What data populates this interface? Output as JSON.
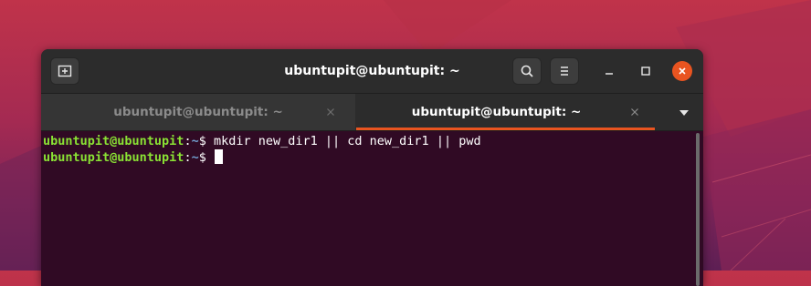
{
  "colors": {
    "accent": "#e95420",
    "terminal_bg": "#300a24",
    "prompt_user": "#8ae234",
    "prompt_path": "#729fcf"
  },
  "window": {
    "title": "ubuntupit@ubuntupit: ~",
    "buttons": {
      "new_tab": "new-tab-icon",
      "search": "search-icon",
      "menu": "hamburger-menu-icon",
      "minimize": "minimize-icon",
      "maximize": "maximize-icon",
      "close": "close-icon"
    }
  },
  "tabs": [
    {
      "label": "ubuntupit@ubuntupit: ~",
      "active": false,
      "close": "×"
    },
    {
      "label": "ubuntupit@ubuntupit: ~",
      "active": true,
      "close": "×"
    }
  ],
  "terminal": {
    "lines": [
      {
        "user": "ubuntupit@ubuntupit",
        "sep": ":",
        "path": "~",
        "symbol": "$ ",
        "command": "mkdir new_dir1 || cd new_dir1 || pwd"
      },
      {
        "user": "ubuntupit@ubuntupit",
        "sep": ":",
        "path": "~",
        "symbol": "$ ",
        "command": ""
      }
    ]
  }
}
